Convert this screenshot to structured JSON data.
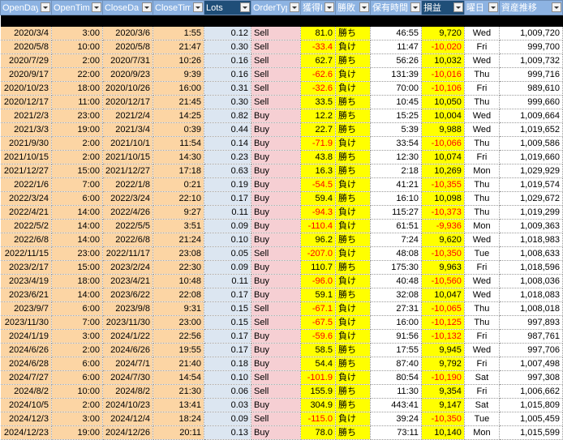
{
  "headers": [
    "OpenDay",
    "OpenTim",
    "CloseDa",
    "CloseTim",
    "Lots",
    "OrderTyp",
    "獲得P",
    "勝敗",
    "保有時間",
    "損益",
    "曜日",
    "資産推移"
  ],
  "rows": [
    {
      "open_day": "2020/3/4",
      "open_time": "3:00",
      "close_day": "2020/3/6",
      "close_time": "1:55",
      "lots": "0.12",
      "type": "Sell",
      "points": "81.0",
      "result": "勝ち",
      "hold": "46:55",
      "pl": "9,720",
      "weekday": "Wed",
      "equity": "1,009,720"
    },
    {
      "open_day": "2020/5/8",
      "open_time": "10:00",
      "close_day": "2020/5/8",
      "close_time": "21:47",
      "lots": "0.30",
      "type": "Sell",
      "points": "-33.4",
      "result": "負け",
      "hold": "11:47",
      "pl": "-10,020",
      "weekday": "Fri",
      "equity": "999,700"
    },
    {
      "open_day": "2020/7/29",
      "open_time": "2:00",
      "close_day": "2020/7/31",
      "close_time": "10:26",
      "lots": "0.16",
      "type": "Sell",
      "points": "62.7",
      "result": "勝ち",
      "hold": "56:26",
      "pl": "10,032",
      "weekday": "Wed",
      "equity": "1,009,732"
    },
    {
      "open_day": "2020/9/17",
      "open_time": "22:00",
      "close_day": "2020/9/23",
      "close_time": "9:39",
      "lots": "0.16",
      "type": "Sell",
      "points": "-62.6",
      "result": "負け",
      "hold": "131:39",
      "pl": "-10,016",
      "weekday": "Thu",
      "equity": "999,716"
    },
    {
      "open_day": "2020/10/23",
      "open_time": "18:00",
      "close_day": "2020/10/26",
      "close_time": "16:00",
      "lots": "0.31",
      "type": "Sell",
      "points": "-32.6",
      "result": "負け",
      "hold": "70:00",
      "pl": "-10,106",
      "weekday": "Fri",
      "equity": "989,610"
    },
    {
      "open_day": "2020/12/17",
      "open_time": "11:00",
      "close_day": "2020/12/17",
      "close_time": "21:45",
      "lots": "0.30",
      "type": "Sell",
      "points": "33.5",
      "result": "勝ち",
      "hold": "10:45",
      "pl": "10,050",
      "weekday": "Thu",
      "equity": "999,660"
    },
    {
      "open_day": "2021/2/3",
      "open_time": "23:00",
      "close_day": "2021/2/4",
      "close_time": "14:25",
      "lots": "0.82",
      "type": "Buy",
      "points": "12.2",
      "result": "勝ち",
      "hold": "15:25",
      "pl": "10,004",
      "weekday": "Wed",
      "equity": "1,009,664"
    },
    {
      "open_day": "2021/3/3",
      "open_time": "19:00",
      "close_day": "2021/3/4",
      "close_time": "0:39",
      "lots": "0.44",
      "type": "Buy",
      "points": "22.7",
      "result": "勝ち",
      "hold": "5:39",
      "pl": "9,988",
      "weekday": "Wed",
      "equity": "1,019,652"
    },
    {
      "open_day": "2021/9/30",
      "open_time": "2:00",
      "close_day": "2021/10/1",
      "close_time": "11:54",
      "lots": "0.14",
      "type": "Buy",
      "points": "-71.9",
      "result": "負け",
      "hold": "33:54",
      "pl": "-10,066",
      "weekday": "Thu",
      "equity": "1,009,586"
    },
    {
      "open_day": "2021/10/15",
      "open_time": "2:00",
      "close_day": "2021/10/15",
      "close_time": "14:30",
      "lots": "0.23",
      "type": "Buy",
      "points": "43.8",
      "result": "勝ち",
      "hold": "12:30",
      "pl": "10,074",
      "weekday": "Fri",
      "equity": "1,019,660"
    },
    {
      "open_day": "2021/12/27",
      "open_time": "15:00",
      "close_day": "2021/12/27",
      "close_time": "17:18",
      "lots": "0.63",
      "type": "Buy",
      "points": "16.3",
      "result": "勝ち",
      "hold": "2:18",
      "pl": "10,269",
      "weekday": "Mon",
      "equity": "1,029,929"
    },
    {
      "open_day": "2022/1/6",
      "open_time": "7:00",
      "close_day": "2022/1/8",
      "close_time": "0:21",
      "lots": "0.19",
      "type": "Buy",
      "points": "-54.5",
      "result": "負け",
      "hold": "41:21",
      "pl": "-10,355",
      "weekday": "Thu",
      "equity": "1,019,574"
    },
    {
      "open_day": "2022/3/24",
      "open_time": "6:00",
      "close_day": "2022/3/24",
      "close_time": "22:10",
      "lots": "0.17",
      "type": "Buy",
      "points": "59.4",
      "result": "勝ち",
      "hold": "16:10",
      "pl": "10,098",
      "weekday": "Thu",
      "equity": "1,029,672"
    },
    {
      "open_day": "2022/4/21",
      "open_time": "14:00",
      "close_day": "2022/4/26",
      "close_time": "9:27",
      "lots": "0.11",
      "type": "Buy",
      "points": "-94.3",
      "result": "負け",
      "hold": "115:27",
      "pl": "-10,373",
      "weekday": "Thu",
      "equity": "1,019,299"
    },
    {
      "open_day": "2022/5/2",
      "open_time": "14:00",
      "close_day": "2022/5/5",
      "close_time": "3:51",
      "lots": "0.09",
      "type": "Buy",
      "points": "-110.4",
      "result": "負け",
      "hold": "61:51",
      "pl": "-9,936",
      "weekday": "Mon",
      "equity": "1,009,363"
    },
    {
      "open_day": "2022/6/8",
      "open_time": "14:00",
      "close_day": "2022/6/8",
      "close_time": "21:24",
      "lots": "0.10",
      "type": "Buy",
      "points": "96.2",
      "result": "勝ち",
      "hold": "7:24",
      "pl": "9,620",
      "weekday": "Wed",
      "equity": "1,018,983"
    },
    {
      "open_day": "2022/11/15",
      "open_time": "23:00",
      "close_day": "2022/11/17",
      "close_time": "23:08",
      "lots": "0.05",
      "type": "Sell",
      "points": "-207.0",
      "result": "負け",
      "hold": "48:08",
      "pl": "-10,350",
      "weekday": "Tue",
      "equity": "1,008,633"
    },
    {
      "open_day": "2023/2/17",
      "open_time": "15:00",
      "close_day": "2023/2/24",
      "close_time": "22:30",
      "lots": "0.09",
      "type": "Buy",
      "points": "110.7",
      "result": "勝ち",
      "hold": "175:30",
      "pl": "9,963",
      "weekday": "Fri",
      "equity": "1,018,596"
    },
    {
      "open_day": "2023/4/19",
      "open_time": "18:00",
      "close_day": "2023/4/21",
      "close_time": "10:48",
      "lots": "0.11",
      "type": "Buy",
      "points": "-96.0",
      "result": "負け",
      "hold": "40:48",
      "pl": "-10,560",
      "weekday": "Wed",
      "equity": "1,008,036"
    },
    {
      "open_day": "2023/6/21",
      "open_time": "14:00",
      "close_day": "2023/6/22",
      "close_time": "22:08",
      "lots": "0.17",
      "type": "Buy",
      "points": "59.1",
      "result": "勝ち",
      "hold": "32:08",
      "pl": "10,047",
      "weekday": "Wed",
      "equity": "1,018,083"
    },
    {
      "open_day": "2023/9/7",
      "open_time": "6:00",
      "close_day": "2023/9/8",
      "close_time": "9:31",
      "lots": "0.15",
      "type": "Sell",
      "points": "-67.1",
      "result": "負け",
      "hold": "27:31",
      "pl": "-10,065",
      "weekday": "Thu",
      "equity": "1,008,018"
    },
    {
      "open_day": "2023/11/30",
      "open_time": "7:00",
      "close_day": "2023/11/30",
      "close_time": "23:00",
      "lots": "0.15",
      "type": "Sell",
      "points": "-67.5",
      "result": "負け",
      "hold": "16:00",
      "pl": "-10,125",
      "weekday": "Thu",
      "equity": "997,893"
    },
    {
      "open_day": "2024/1/19",
      "open_time": "3:00",
      "close_day": "2024/1/22",
      "close_time": "22:56",
      "lots": "0.17",
      "type": "Buy",
      "points": "-59.6",
      "result": "負け",
      "hold": "91:56",
      "pl": "-10,132",
      "weekday": "Fri",
      "equity": "987,761"
    },
    {
      "open_day": "2024/6/26",
      "open_time": "2:00",
      "close_day": "2024/6/26",
      "close_time": "19:55",
      "lots": "0.17",
      "type": "Buy",
      "points": "58.5",
      "result": "勝ち",
      "hold": "17:55",
      "pl": "9,945",
      "weekday": "Wed",
      "equity": "997,706"
    },
    {
      "open_day": "2024/6/28",
      "open_time": "6:00",
      "close_day": "2024/7/1",
      "close_time": "21:40",
      "lots": "0.18",
      "type": "Buy",
      "points": "54.4",
      "result": "勝ち",
      "hold": "87:40",
      "pl": "9,792",
      "weekday": "Fri",
      "equity": "1,007,498"
    },
    {
      "open_day": "2024/7/27",
      "open_time": "6:00",
      "close_day": "2024/7/30",
      "close_time": "14:54",
      "lots": "0.10",
      "type": "Sell",
      "points": "-101.9",
      "result": "負け",
      "hold": "80:54",
      "pl": "-10,190",
      "weekday": "Sat",
      "equity": "997,308"
    },
    {
      "open_day": "2024/8/2",
      "open_time": "10:00",
      "close_day": "2024/8/2",
      "close_time": "21:30",
      "lots": "0.06",
      "type": "Sell",
      "points": "155.9",
      "result": "勝ち",
      "hold": "11:30",
      "pl": "9,354",
      "weekday": "Fri",
      "equity": "1,006,662"
    },
    {
      "open_day": "2024/10/5",
      "open_time": "2:00",
      "close_day": "2024/10/23",
      "close_time": "13:41",
      "lots": "0.03",
      "type": "Buy",
      "points": "304.9",
      "result": "勝ち",
      "hold": "443:41",
      "pl": "9,147",
      "weekday": "Sat",
      "equity": "1,015,809"
    },
    {
      "open_day": "2024/12/3",
      "open_time": "3:00",
      "close_day": "2024/12/4",
      "close_time": "18:24",
      "lots": "0.09",
      "type": "Sell",
      "points": "-115.0",
      "result": "負け",
      "hold": "39:24",
      "pl": "-10,350",
      "weekday": "Tue",
      "equity": "1,005,459"
    },
    {
      "open_day": "2024/12/23",
      "open_time": "19:00",
      "close_day": "2024/12/26",
      "close_time": "20:11",
      "lots": "0.13",
      "type": "Buy",
      "points": "78.0",
      "result": "勝ち",
      "hold": "73:11",
      "pl": "10,140",
      "weekday": "Mon",
      "equity": "1,015,599"
    }
  ]
}
